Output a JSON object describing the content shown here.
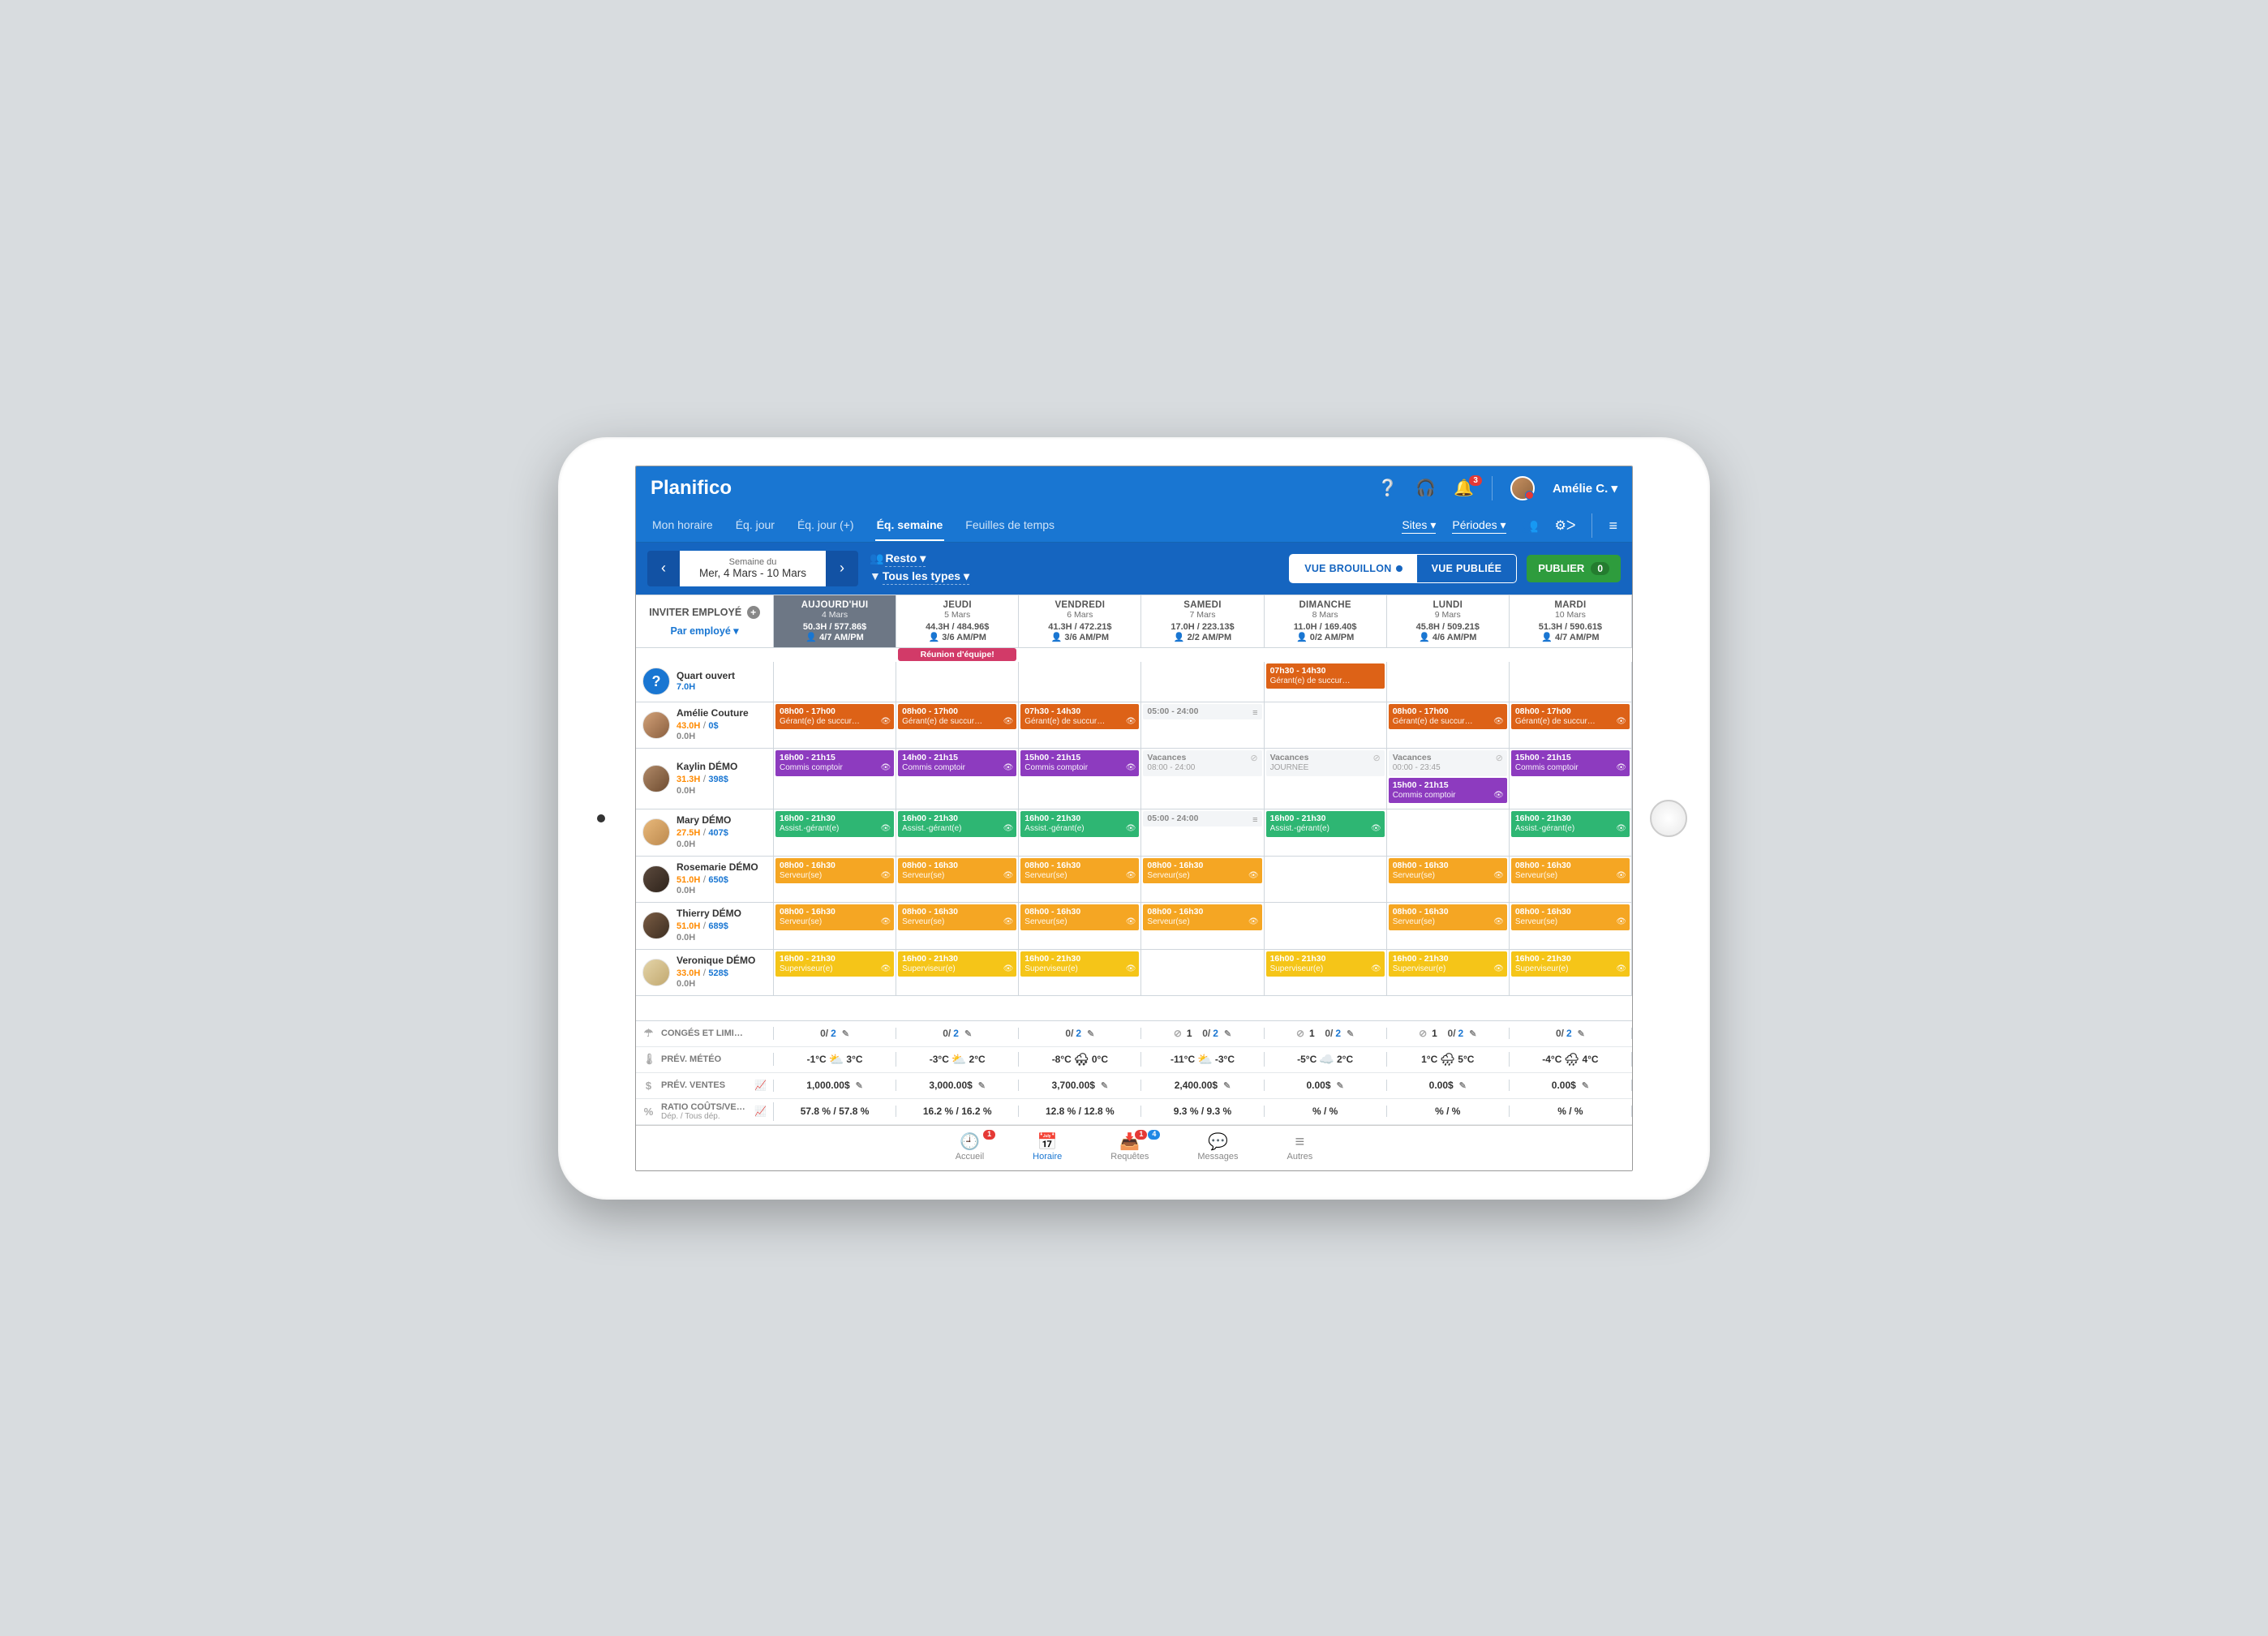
{
  "brand": "Planifico",
  "user": {
    "name": "Amélie C.",
    "notif_count": "3"
  },
  "topnav_right": {
    "sites": "Sites",
    "periodes": "Périodes"
  },
  "tabs": [
    {
      "label": "Mon horaire",
      "active": false
    },
    {
      "label": "Éq. jour",
      "active": false
    },
    {
      "label": "Éq. jour (+)",
      "active": false
    },
    {
      "label": "Éq. semaine",
      "active": true
    },
    {
      "label": "Feuilles de temps",
      "active": false
    }
  ],
  "week": {
    "sup": "Semaine du",
    "range": "Mer, 4 Mars - 10 Mars"
  },
  "filters": {
    "site_pre": "👥",
    "site": "Resto",
    "type_pre": "▼",
    "type": "Tous les types"
  },
  "views": {
    "draft": "VUE BROUILLON",
    "published": "VUE PUBLIÉE"
  },
  "publish": {
    "label": "PUBLIER",
    "count": "0"
  },
  "empcol": {
    "invite": "INVITER EMPLOYÉ",
    "by": "Par employé"
  },
  "days": [
    {
      "name": "AUJOURD'HUI",
      "date": "4 Mars",
      "stats": "50.3H / 577.86$",
      "shifts": "👤 4/7 AM/PM",
      "today": true
    },
    {
      "name": "JEUDI",
      "date": "5 Mars",
      "stats": "44.3H / 484.96$",
      "shifts": "👤 3/6 AM/PM",
      "banner": "Réunion d'équipe!"
    },
    {
      "name": "VENDREDI",
      "date": "6 Mars",
      "stats": "41.3H / 472.21$",
      "shifts": "👤 3/6 AM/PM"
    },
    {
      "name": "SAMEDI",
      "date": "7 Mars",
      "stats": "17.0H / 223.13$",
      "shifts": "👤 2/2 AM/PM"
    },
    {
      "name": "DIMANCHE",
      "date": "8 Mars",
      "stats": "11.0H / 169.40$",
      "shifts": "👤 0/2 AM/PM"
    },
    {
      "name": "LUNDI",
      "date": "9 Mars",
      "stats": "45.8H / 509.21$",
      "shifts": "👤 4/6 AM/PM"
    },
    {
      "name": "MARDI",
      "date": "10 Mars",
      "stats": "51.3H / 590.61$",
      "shifts": "👤 4/7 AM/PM"
    }
  ],
  "rows": [
    {
      "name": "Quart ouvert",
      "hours": "7.0H",
      "open": true,
      "cells": [
        [],
        [],
        [],
        [],
        [
          {
            "time": "07h30 - 14h30",
            "role": "Gérant(e) de succur…",
            "color": "c-orange",
            "noeye": true
          }
        ],
        [],
        []
      ]
    },
    {
      "name": "Amélie Couture",
      "hours": "43.0H",
      "cost": "0$",
      "zero": "0.0H",
      "av": "a1",
      "cells": [
        [
          {
            "time": "08h00 - 17h00",
            "role": "Gérant(e) de succur…",
            "color": "c-orange"
          }
        ],
        [
          {
            "time": "08h00 - 17h00",
            "role": "Gérant(e) de succur…",
            "color": "c-orange"
          }
        ],
        [
          {
            "time": "07h30 - 14h30",
            "role": "Gérant(e) de succur…",
            "color": "c-orange"
          }
        ],
        [
          {
            "time": "05:00 - 24:00",
            "role": "",
            "color": "c-grey",
            "bars": true
          }
        ],
        [],
        [
          {
            "time": "08h00 - 17h00",
            "role": "Gérant(e) de succur…",
            "color": "c-orange"
          }
        ],
        [
          {
            "time": "08h00 - 17h00",
            "role": "Gérant(e) de succur…",
            "color": "c-orange"
          }
        ]
      ]
    },
    {
      "name": "Kaylin DÉMO",
      "hours": "31.3H",
      "cost": "398$",
      "zero": "0.0H",
      "av": "a2",
      "tall": true,
      "cells": [
        [
          {
            "time": "16h00 - 21h15",
            "role": "Commis comptoir",
            "color": "c-purple"
          }
        ],
        [
          {
            "time": "14h00 - 21h15",
            "role": "Commis comptoir",
            "color": "c-purple"
          }
        ],
        [
          {
            "time": "15h00 - 21h15",
            "role": "Commis comptoir",
            "color": "c-purple"
          }
        ],
        [
          {
            "time": "Vacances",
            "role": "08:00 - 24:00",
            "color": "c-grey",
            "block": true
          }
        ],
        [
          {
            "time": "Vacances",
            "role": "JOURNÉE",
            "color": "c-grey",
            "block": true
          }
        ],
        [
          {
            "time": "Vacances",
            "role": "00:00 - 23:45",
            "color": "c-grey",
            "block": true
          },
          {
            "time": "15h00 - 21h15",
            "role": "Commis comptoir",
            "color": "c-purple"
          }
        ],
        [
          {
            "time": "15h00 - 21h15",
            "role": "Commis comptoir",
            "color": "c-purple"
          }
        ]
      ]
    },
    {
      "name": "Mary DÉMO",
      "hours": "27.5H",
      "cost": "407$",
      "zero": "0.0H",
      "av": "a3",
      "cells": [
        [
          {
            "time": "16h00 - 21h30",
            "role": "Assist.-gérant(e)",
            "color": "c-green"
          }
        ],
        [
          {
            "time": "16h00 - 21h30",
            "role": "Assist.-gérant(e)",
            "color": "c-green"
          }
        ],
        [
          {
            "time": "16h00 - 21h30",
            "role": "Assist.-gérant(e)",
            "color": "c-green"
          }
        ],
        [
          {
            "time": "05:00 - 24:00",
            "role": "",
            "color": "c-grey",
            "bars": true
          }
        ],
        [
          {
            "time": "16h00 - 21h30",
            "role": "Assist.-gérant(e)",
            "color": "c-green"
          }
        ],
        [],
        [
          {
            "time": "16h00 - 21h30",
            "role": "Assist.-gérant(e)",
            "color": "c-green"
          }
        ]
      ]
    },
    {
      "name": "Rosemarie DÉMO",
      "hours": "51.0H",
      "cost": "650$",
      "zero": "0.0H",
      "av": "a4",
      "cells": [
        [
          {
            "time": "08h00 - 16h30",
            "role": "Serveur(se)",
            "color": "c-amber"
          }
        ],
        [
          {
            "time": "08h00 - 16h30",
            "role": "Serveur(se)",
            "color": "c-amber"
          }
        ],
        [
          {
            "time": "08h00 - 16h30",
            "role": "Serveur(se)",
            "color": "c-amber"
          }
        ],
        [
          {
            "time": "08h00 - 16h30",
            "role": "Serveur(se)",
            "color": "c-amber"
          }
        ],
        [],
        [
          {
            "time": "08h00 - 16h30",
            "role": "Serveur(se)",
            "color": "c-amber"
          }
        ],
        [
          {
            "time": "08h00 - 16h30",
            "role": "Serveur(se)",
            "color": "c-amber"
          }
        ]
      ]
    },
    {
      "name": "Thierry DÉMO",
      "hours": "51.0H",
      "cost": "689$",
      "zero": "0.0H",
      "av": "a5",
      "cells": [
        [
          {
            "time": "08h00 - 16h30",
            "role": "Serveur(se)",
            "color": "c-amber"
          }
        ],
        [
          {
            "time": "08h00 - 16h30",
            "role": "Serveur(se)",
            "color": "c-amber"
          }
        ],
        [
          {
            "time": "08h00 - 16h30",
            "role": "Serveur(se)",
            "color": "c-amber"
          }
        ],
        [
          {
            "time": "08h00 - 16h30",
            "role": "Serveur(se)",
            "color": "c-amber"
          }
        ],
        [],
        [
          {
            "time": "08h00 - 16h30",
            "role": "Serveur(se)",
            "color": "c-amber"
          }
        ],
        [
          {
            "time": "08h00 - 16h30",
            "role": "Serveur(se)",
            "color": "c-amber"
          }
        ]
      ]
    },
    {
      "name": "Veronique DÉMO",
      "hours": "33.0H",
      "cost": "528$",
      "zero": "0.0H",
      "av": "a6",
      "cells": [
        [
          {
            "time": "16h00 - 21h30",
            "role": "Superviseur(e)",
            "color": "c-yellow"
          }
        ],
        [
          {
            "time": "16h00 - 21h30",
            "role": "Superviseur(e)",
            "color": "c-yellow"
          }
        ],
        [
          {
            "time": "16h00 - 21h30",
            "role": "Superviseur(e)",
            "color": "c-yellow"
          }
        ],
        [],
        [
          {
            "time": "16h00 - 21h30",
            "role": "Superviseur(e)",
            "color": "c-yellow"
          }
        ],
        [
          {
            "time": "16h00 - 21h30",
            "role": "Superviseur(e)",
            "color": "c-yellow"
          }
        ],
        [
          {
            "time": "16h00 - 21h30",
            "role": "Superviseur(e)",
            "color": "c-yellow"
          }
        ]
      ]
    }
  ],
  "footers": {
    "conges": {
      "icon": "☂",
      "label": "CONGÉS ET LIMI…",
      "cells": [
        {
          "a": "0/",
          "b": "2"
        },
        {
          "a": "0/",
          "b": "2"
        },
        {
          "a": "0/",
          "b": "2"
        },
        {
          "cancel": "1",
          "a": "0/",
          "b": "2"
        },
        {
          "cancel": "1",
          "a": "0/",
          "b": "2"
        },
        {
          "cancel": "1",
          "a": "0/",
          "b": "2"
        },
        {
          "a": "0/",
          "b": "2"
        }
      ]
    },
    "meteo": {
      "icon": "🌡",
      "label": "PRÉV. MÉTÉO",
      "cells": [
        {
          "lo": "-1°C",
          "ic": "⛅",
          "hi": "3°C"
        },
        {
          "lo": "-3°C",
          "ic": "⛅",
          "hi": "2°C"
        },
        {
          "lo": "-8°C",
          "ic": "🌨",
          "hi": "0°C"
        },
        {
          "lo": "-11°C",
          "ic": "⛅",
          "hi": "-3°C"
        },
        {
          "lo": "-5°C",
          "ic": "☁️",
          "hi": "2°C"
        },
        {
          "lo": "1°C",
          "ic": "🌧",
          "hi": "5°C"
        },
        {
          "lo": "-4°C",
          "ic": "🌧",
          "hi": "4°C"
        }
      ]
    },
    "ventes": {
      "icon": "$",
      "label": "PRÉV. VENTES",
      "cells": [
        "1,000.00$",
        "3,000.00$",
        "3,700.00$",
        "2,400.00$",
        "0.00$",
        "0.00$",
        "0.00$"
      ]
    },
    "ratio": {
      "icon": "%",
      "label": "RATIO COÛTS/VE…",
      "sub": "Dép. / Tous dép.",
      "cells": [
        "57.8 % / 57.8 %",
        "16.2 % / 16.2 %",
        "12.8 % / 12.8 %",
        "9.3 % / 9.3 %",
        "% / %",
        "% / %",
        "% / %"
      ]
    }
  },
  "bottomnav": [
    {
      "icon": "🕘",
      "label": "Accueil",
      "badges": [
        {
          "n": "1",
          "c": ""
        }
      ]
    },
    {
      "icon": "📅",
      "label": "Horaire",
      "active": true
    },
    {
      "icon": "📥",
      "label": "Requêtes",
      "badges": [
        {
          "n": "1",
          "c": ""
        },
        {
          "n": "4",
          "c": "blue"
        }
      ]
    },
    {
      "icon": "💬",
      "label": "Messages"
    },
    {
      "icon": "≡",
      "label": "Autres"
    }
  ]
}
